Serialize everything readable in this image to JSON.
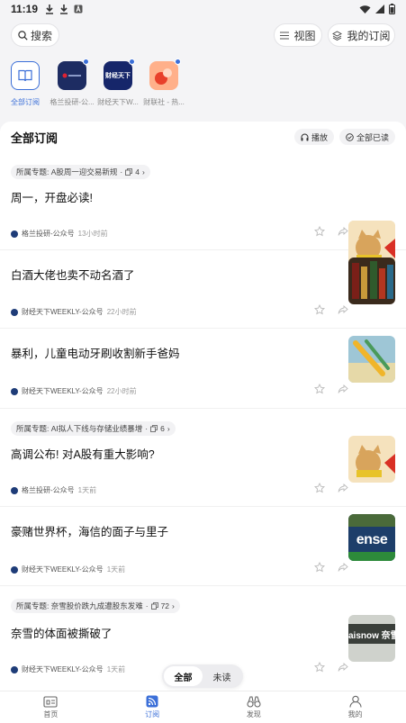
{
  "status_bar": {
    "time": "11:19",
    "left_icons": [
      "download-icon",
      "download-icon",
      "app-a-icon"
    ],
    "right_icons": [
      "wifi-icon",
      "signal-icon",
      "battery-icon"
    ]
  },
  "top_bar": {
    "search_label": "搜索",
    "view_label": "视图",
    "my_subscriptions_label": "我的订阅"
  },
  "subscriptions": [
    {
      "label": "全部订阅",
      "active": true,
      "icon": "book-icon"
    },
    {
      "label": "格兰投研-公...",
      "active": false,
      "dot": true
    },
    {
      "label": "财经天下W...",
      "active": false,
      "dot": true,
      "logo_text": "财经天下"
    },
    {
      "label": "财联社 - 热...",
      "active": false,
      "dot": true
    }
  ],
  "card_header": {
    "title": "全部订阅",
    "play_label": "播放",
    "mark_all_read_label": "全部已读"
  },
  "articles": [
    {
      "topic": "所属专题: A股周一迎交易新规",
      "topic_count": "4",
      "title": "周一，开盘必读!",
      "source": "格兰投研-公众号",
      "time": "13小时前",
      "thumb": "cat"
    },
    {
      "title": "白酒大佬也卖不动名酒了",
      "source": "财经天下WEEKLY-公众号",
      "time": "22小时前",
      "thumb": "bottles"
    },
    {
      "title": "暴利，儿童电动牙刷收割新手爸妈",
      "source": "财经天下WEEKLY-公众号",
      "time": "22小时前",
      "thumb": "toothbrush"
    },
    {
      "topic": "所属专题: AI拟人下线与存储业绩暴增",
      "topic_count": "6",
      "title": "高调公布! 对A股有重大影响?",
      "source": "格兰投研-公众号",
      "time": "1天前",
      "thumb": "cat"
    },
    {
      "title": "豪赌世界杯，海信的面子与里子",
      "source": "财经天下WEEKLY-公众号",
      "time": "1天前",
      "thumb": "stadium",
      "thumb_text": "ense"
    },
    {
      "topic": "所属专题: 奈雪股价跌九成遭股东发难",
      "topic_count": "72",
      "title": "奈雪的体面被撕破了",
      "source": "财经天下WEEKLY-公众号",
      "time": "1天前",
      "thumb": "store",
      "thumb_text": "aisnow 奈雪"
    }
  ],
  "filter": {
    "options": [
      "全部",
      "未读"
    ],
    "selected": "全部"
  },
  "bottom_nav": [
    {
      "label": "首页",
      "icon": "home-icon",
      "active": false
    },
    {
      "label": "订阅",
      "icon": "rss-icon",
      "active": true
    },
    {
      "label": "发现",
      "icon": "binoculars-icon",
      "active": false
    },
    {
      "label": "我的",
      "icon": "profile-icon",
      "active": false
    }
  ],
  "colors": {
    "accent": "#3b6fd8",
    "background": "#f4f4f6"
  }
}
